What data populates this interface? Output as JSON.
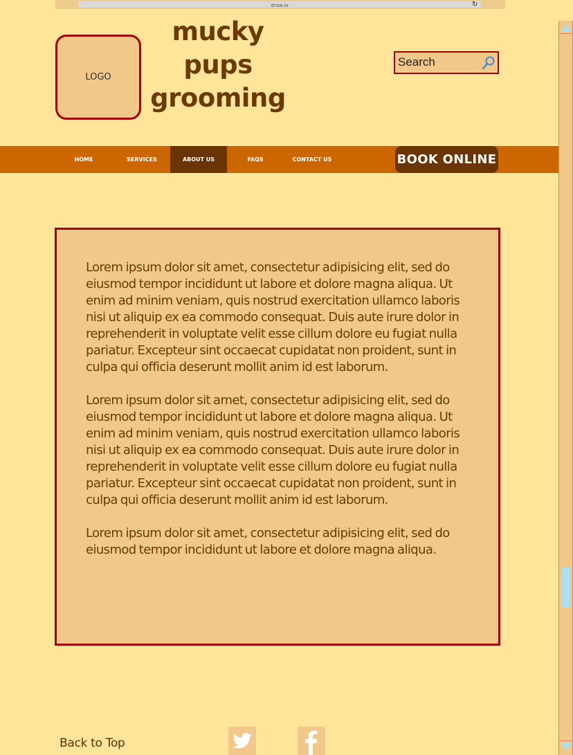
{
  "browser": {
    "url": "draw.io",
    "reload_icon": "reload-icon"
  },
  "header": {
    "logo_text": "LOGO",
    "brand_line1": "mucky",
    "brand_line2": "pups",
    "brand_line3": "grooming"
  },
  "search": {
    "placeholder": "Search",
    "icon": "search-icon"
  },
  "nav": {
    "items": [
      {
        "label": "HOME"
      },
      {
        "label": "SERVICES"
      },
      {
        "label": "ABOUT US"
      },
      {
        "label": "FAQS"
      },
      {
        "label": "CONTACT US"
      }
    ],
    "active": "ABOUT US",
    "book_label": "BOOK ONLINE"
  },
  "content": {
    "paragraphs": [
      "Lorem ipsum dolor sit amet, consectetur adipisicing elit, sed do eiusmod tempor incididunt ut labore et dolore magna aliqua. Ut enim ad minim veniam, quis nostrud exercitation ullamco laboris nisi ut aliquip ex ea commodo consequat. Duis aute irure dolor in reprehenderit in voluptate velit esse cillum dolore eu fugiat nulla pariatur. Excepteur sint occaecat cupidatat non proident, sunt in culpa qui officia deserunt mollit anim id est laborum.",
      "Lorem ipsum dolor sit amet, consectetur adipisicing elit, sed do eiusmod tempor incididunt ut labore et dolore magna aliqua. Ut enim ad minim veniam, quis nostrud exercitation ullamco laboris nisi ut aliquip ex ea commodo consequat. Duis aute irure dolor in reprehenderit in voluptate velit esse cillum dolore eu fugiat nulla pariatur. Excepteur sint occaecat cupidatat non proident, sunt in culpa qui officia deserunt mollit anim id est laborum.",
      "Lorem ipsum dolor sit amet, consectetur adipisicing elit, sed do eiusmod tempor incididunt ut labore et dolore magna aliqua."
    ]
  },
  "footer": {
    "back_to_top": "Back to Top",
    "social": [
      "twitter-icon",
      "facebook-icon"
    ]
  },
  "colors": {
    "page_bg": "#ffe599",
    "panel": "#f1c889",
    "nav": "#cc6600",
    "nav_active": "#6a3404",
    "border": "#a30000",
    "brand_text": "#6b3a04",
    "scroll_accent": "#a8e0f4"
  }
}
